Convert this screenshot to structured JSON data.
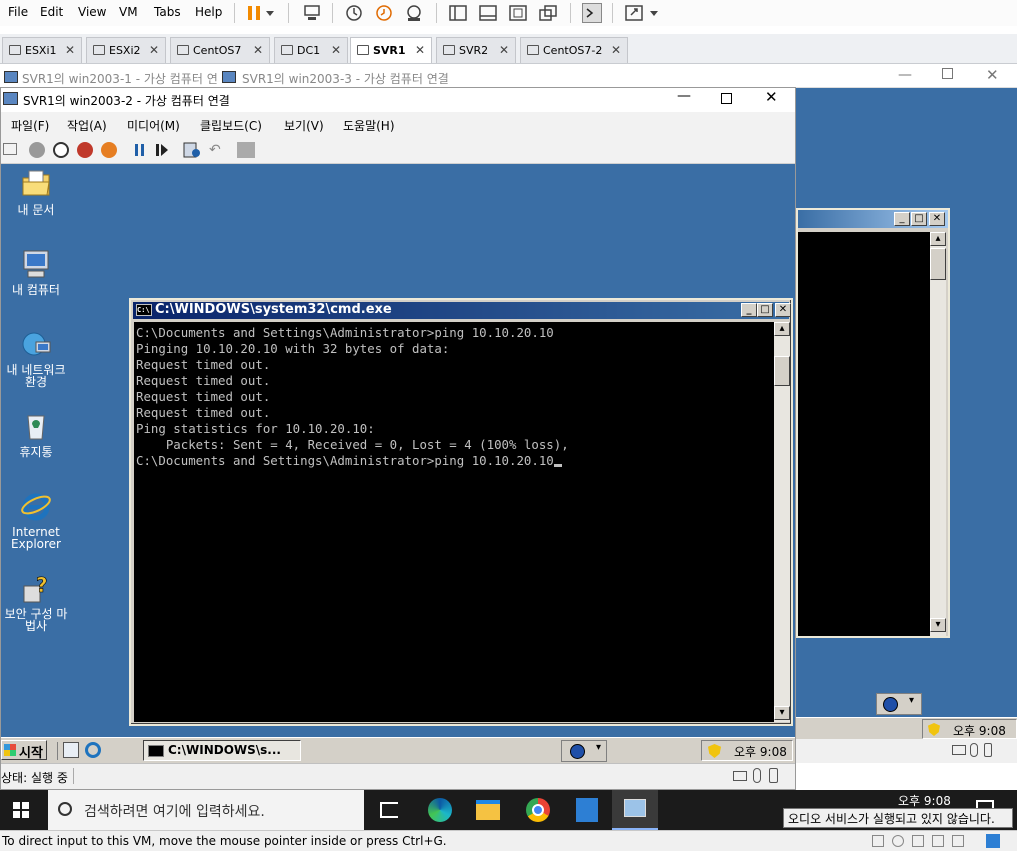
{
  "vmware": {
    "menu": [
      "File",
      "Edit",
      "View",
      "VM",
      "Tabs",
      "Help"
    ],
    "tabs": [
      {
        "label": "ESXi1",
        "active": false
      },
      {
        "label": "ESXi2",
        "active": false
      },
      {
        "label": "CentOS7",
        "active": false
      },
      {
        "label": "DC1",
        "active": false
      },
      {
        "label": "SVR1",
        "active": true
      },
      {
        "label": "SVR2",
        "active": false
      },
      {
        "label": "CentOS7-2",
        "active": false
      }
    ],
    "status_text": "To direct input to this VM, move the mouse pointer inside or press Ctrl+G."
  },
  "background_windows": {
    "title_1": "SVR1의 win2003-1 - 가상 컴퓨터 연",
    "title_3": "SVR1의 win2003-3 - 가상 컴퓨터 연결",
    "tray_time": "오후 9:08"
  },
  "hyperv": {
    "title": "SVR1의 win2003-2 - 가상 컴퓨터 연결",
    "menu": [
      "파일(F)",
      "작업(A)",
      "미디어(M)",
      "클립보드(C)",
      "보기(V)",
      "도움말(H)"
    ],
    "status": "상태: 실행 중"
  },
  "desktop_icons": [
    {
      "label": "내 문서",
      "icon": "my-documents-icon"
    },
    {
      "label": "내 컴퓨터",
      "icon": "my-computer-icon"
    },
    {
      "label": "내 네트워크 환경",
      "icon": "network-places-icon"
    },
    {
      "label": "휴지통",
      "icon": "recycle-bin-icon"
    },
    {
      "label": "Internet Explorer",
      "icon": "internet-explorer-icon"
    },
    {
      "label": "보안 구성 마법사",
      "icon": "security-wizard-icon"
    }
  ],
  "cmd": {
    "title": "C:\\WINDOWS\\system32\\cmd.exe",
    "lines": [
      "C:\\Documents and Settings\\Administrator>ping 10.10.20.10",
      "",
      "Pinging 10.10.20.10 with 32 bytes of data:",
      "",
      "Request timed out.",
      "Request timed out.",
      "Request timed out.",
      "Request timed out.",
      "",
      "Ping statistics for 10.10.20.10:",
      "    Packets: Sent = 4, Received = 0, Lost = 4 (100% loss),",
      "",
      "C:\\Documents and Settings\\Administrator>ping 10.10.20.10"
    ]
  },
  "xp_taskbar": {
    "start_label": "시작",
    "task_label": "C:\\WINDOWS\\s...",
    "clock": "오후 9:08"
  },
  "win10": {
    "search_placeholder": "검색하려면 여기에 입력하세요.",
    "clock": "오후 9:08",
    "notification": "오디오 서비스가 실행되고 있지 않습니다."
  }
}
